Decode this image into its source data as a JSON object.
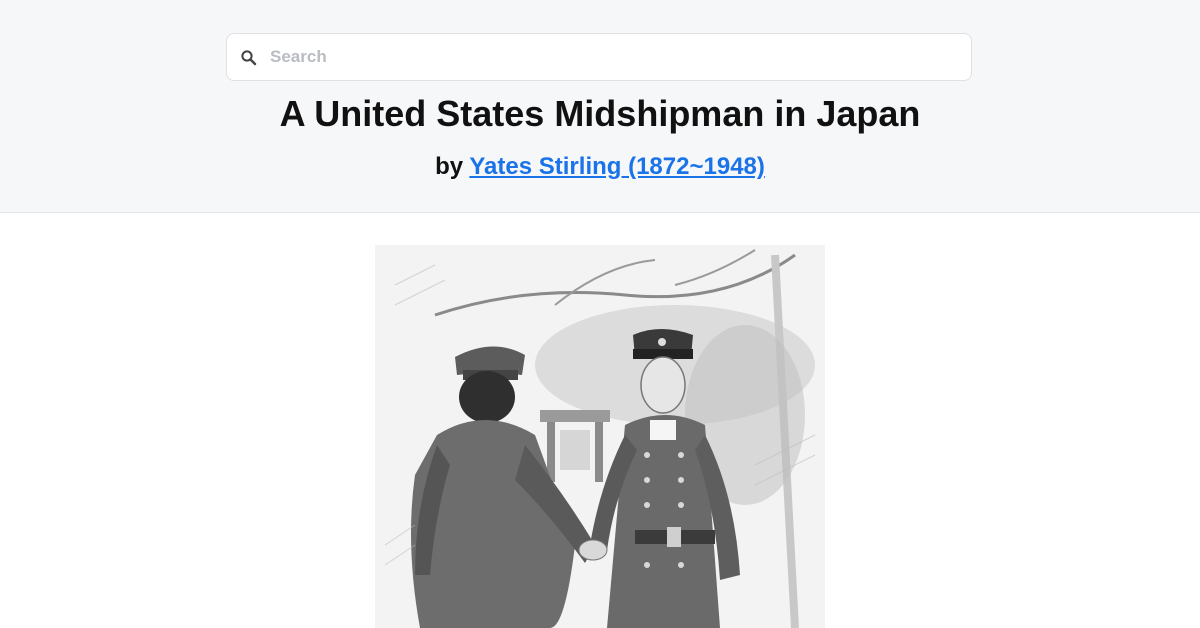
{
  "search": {
    "placeholder": "Search"
  },
  "book": {
    "title": "A United States Midshipman in Japan",
    "by_prefix": "by",
    "author": "Yates Stirling (1872~1948)"
  },
  "icons": {
    "search": "search-icon"
  },
  "colors": {
    "link": "#1a73e8",
    "header_bg": "#f6f7f9"
  }
}
